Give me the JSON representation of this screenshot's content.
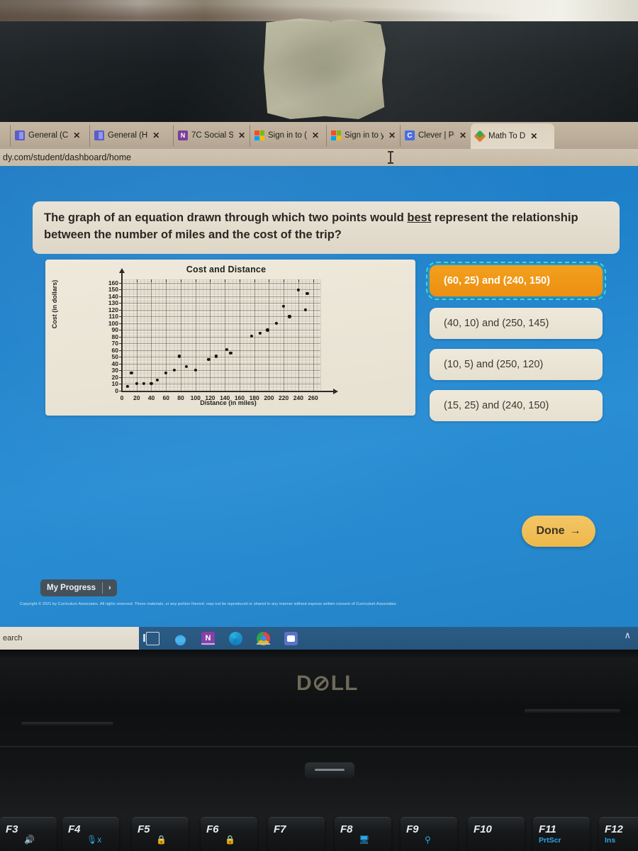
{
  "browser": {
    "tabs": [
      {
        "label": "General (C",
        "icon": "teams-icon",
        "active": false
      },
      {
        "label": "General (H",
        "icon": "teams-icon",
        "active": false
      },
      {
        "label": "7C Social S",
        "icon": "onenote-icon",
        "active": false
      },
      {
        "label": "Sign in to (",
        "icon": "microsoft-icon",
        "active": false
      },
      {
        "label": "Sign in to y",
        "icon": "microsoft-icon",
        "active": false
      },
      {
        "label": "Clever | Po",
        "icon": "clever-icon",
        "active": false
      },
      {
        "label": "Math To D",
        "icon": "iready-icon",
        "active": true
      }
    ],
    "close_label": "✕",
    "url": "dy.com/student/dashboard/home"
  },
  "question": {
    "part1": "The graph of an equation drawn through which two points would ",
    "emphasis": "best",
    "part2": " represent the relationship between the number of miles and the cost of the trip?"
  },
  "chart_data": {
    "type": "scatter",
    "title": "Cost and Distance",
    "xlabel": "Distance (in miles)",
    "ylabel": "Cost (in dollars)",
    "xlim": [
      0,
      270
    ],
    "ylim": [
      0,
      165
    ],
    "xticks": [
      0,
      20,
      40,
      60,
      80,
      100,
      120,
      140,
      160,
      180,
      200,
      220,
      240,
      260
    ],
    "yticks": [
      0,
      10,
      20,
      30,
      40,
      50,
      60,
      70,
      80,
      90,
      100,
      110,
      120,
      130,
      140,
      150,
      160
    ],
    "grid": true,
    "legend": "none",
    "points": [
      {
        "x": 8,
        "y": 6
      },
      {
        "x": 13,
        "y": 26
      },
      {
        "x": 20,
        "y": 11
      },
      {
        "x": 30,
        "y": 11
      },
      {
        "x": 40,
        "y": 11
      },
      {
        "x": 48,
        "y": 16
      },
      {
        "x": 60,
        "y": 26
      },
      {
        "x": 71,
        "y": 31
      },
      {
        "x": 78,
        "y": 51
      },
      {
        "x": 88,
        "y": 36
      },
      {
        "x": 100,
        "y": 31
      },
      {
        "x": 118,
        "y": 46
      },
      {
        "x": 128,
        "y": 51
      },
      {
        "x": 143,
        "y": 61
      },
      {
        "x": 148,
        "y": 56
      },
      {
        "x": 176,
        "y": 81
      },
      {
        "x": 188,
        "y": 85
      },
      {
        "x": 198,
        "y": 90
      },
      {
        "x": 210,
        "y": 100
      },
      {
        "x": 220,
        "y": 125
      },
      {
        "x": 228,
        "y": 110
      },
      {
        "x": 240,
        "y": 149
      },
      {
        "x": 250,
        "y": 120
      },
      {
        "x": 252,
        "y": 144
      }
    ]
  },
  "options": [
    {
      "label": "(60, 25) and (240, 150)",
      "selected": true
    },
    {
      "label": "(40, 10) and (250, 145)",
      "selected": false
    },
    {
      "label": "(10, 5) and (250, 120)",
      "selected": false
    },
    {
      "label": "(15, 25) and (240, 150)",
      "selected": false
    }
  ],
  "done_button": {
    "label": "Done",
    "arrow": "→"
  },
  "progress_button": {
    "label": "My Progress",
    "arrow": "›"
  },
  "copyright": "Copyright © 2021 by Curriculum Associates. All rights reserved. These materials, or any portion thereof, may not be reproduced or shared in any manner without express written consent of Curriculum Associates.",
  "taskbar": {
    "search_placeholder": "earch",
    "chevron": "∧",
    "icons": [
      "task-view-icon",
      "onedrive-icon",
      "onenote-icon",
      "edge-icon",
      "chrome-icon",
      "teams-icon"
    ]
  },
  "laptop": {
    "brand": "D⊘LL",
    "function_keys": [
      {
        "main": "F3",
        "sub": "",
        "glyph": "🔊"
      },
      {
        "main": "F4",
        "sub": "",
        "glyph": "🎙x"
      },
      {
        "main": "F5",
        "sub": "",
        "glyph": "🔒"
      },
      {
        "main": "F6",
        "sub": "",
        "glyph": "🔒"
      },
      {
        "main": "F7",
        "sub": "",
        "glyph": ""
      },
      {
        "main": "F8",
        "sub": "",
        "glyph": "🖥"
      },
      {
        "main": "F9",
        "sub": "",
        "glyph": "⚲"
      },
      {
        "main": "F10",
        "sub": "",
        "glyph": ""
      },
      {
        "main": "F11",
        "sub": "PrtScr",
        "glyph": ""
      },
      {
        "main": "F12",
        "sub": "Ins",
        "glyph": ""
      }
    ]
  },
  "colors": {
    "app_blue": "#2383c8",
    "selected_orange": "#ec8f12",
    "selection_outline": "#3fd8d0",
    "done_yellow": "#edb84a",
    "card_cream": "#e9e3d6"
  }
}
